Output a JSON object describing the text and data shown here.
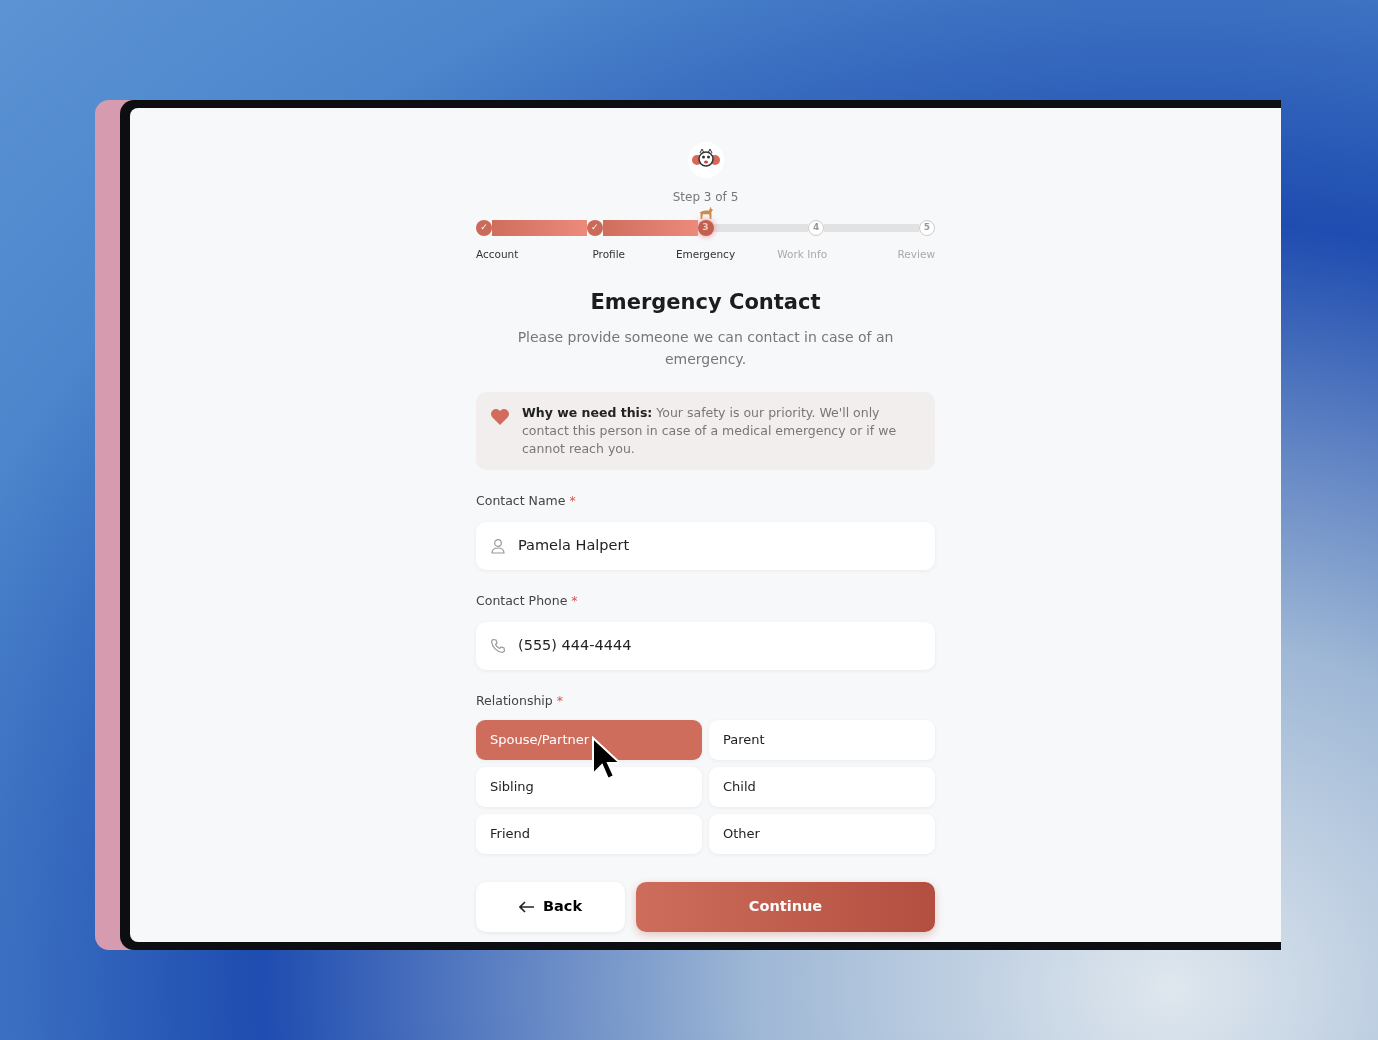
{
  "step_text": "Step 3 of 5",
  "steps": [
    {
      "label": "Account",
      "completed": true,
      "selected": false,
      "number": "✓"
    },
    {
      "label": "Profile",
      "completed": true,
      "selected": false,
      "number": "✓"
    },
    {
      "label": "Emergency",
      "completed": false,
      "selected": true,
      "number": "3"
    },
    {
      "label": "Work Info",
      "completed": false,
      "selected": false,
      "number": "4"
    },
    {
      "label": "Review",
      "completed": false,
      "selected": false,
      "number": "5"
    }
  ],
  "title": "Emergency Contact",
  "subtitle": "Please provide someone we can contact in case of an emergency.",
  "notice": "**Why we need this:** Your safety is our priority. We'll only contact this person in case of a medical emergency or if we cannot reach you.",
  "fields": [
    {
      "label": "Contact Name",
      "required_mark": "*",
      "kind": "person",
      "value": "Pamela Halpert"
    },
    {
      "label": "Contact Phone",
      "required_mark": "*",
      "kind": "phone",
      "value": "(555) 444-4444"
    }
  ],
  "relationship": {
    "label": "Relationship",
    "required_mark": "*",
    "options": [
      {
        "label": "Spouse/Partner",
        "selected": true
      },
      {
        "label": "Parent",
        "selected": false
      },
      {
        "label": "Sibling",
        "selected": false
      },
      {
        "label": "Child",
        "selected": false
      },
      {
        "label": "Friend",
        "selected": false
      },
      {
        "label": "Other",
        "selected": false
      }
    ]
  },
  "buttons": {
    "back": "Back",
    "continue": "Continue"
  }
}
